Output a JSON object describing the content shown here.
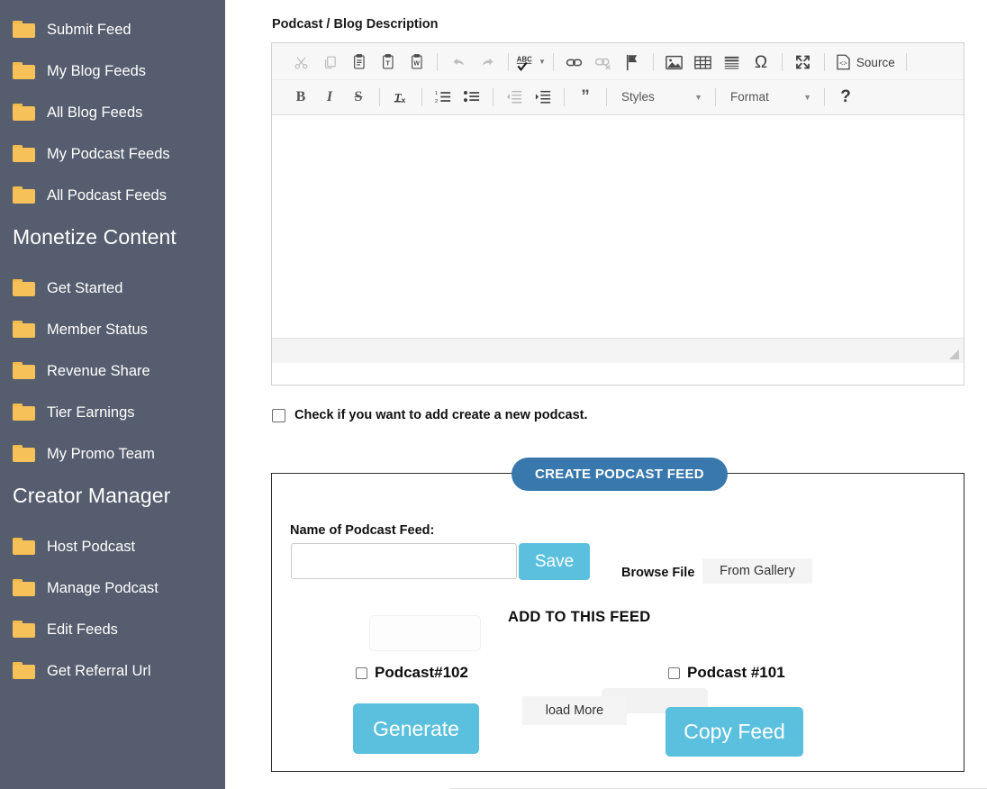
{
  "sidebar": {
    "groups": [
      {
        "title": null,
        "items": [
          {
            "label": "Submit Feed",
            "icon": "folder-icon"
          },
          {
            "label": "My Blog Feeds",
            "icon": "folder-icon"
          },
          {
            "label": "All Blog Feeds",
            "icon": "folder-icon"
          },
          {
            "label": "My Podcast Feeds",
            "icon": "folder-icon"
          },
          {
            "label": "All Podcast Feeds",
            "icon": "folder-icon"
          }
        ]
      },
      {
        "title": "Monetize Content",
        "items": [
          {
            "label": "Get Started",
            "icon": "folder-icon"
          },
          {
            "label": "Member Status",
            "icon": "folder-icon"
          },
          {
            "label": "Revenue Share",
            "icon": "folder-icon"
          },
          {
            "label": "Tier Earnings",
            "icon": "folder-icon"
          },
          {
            "label": "My Promo Team",
            "icon": "folder-icon"
          }
        ]
      },
      {
        "title": "Creator Manager",
        "items": [
          {
            "label": "Host Podcast",
            "icon": "folder-icon"
          },
          {
            "label": "Manage Podcast",
            "icon": "folder-icon"
          },
          {
            "label": "Edit Feeds",
            "icon": "folder-icon"
          },
          {
            "label": "Get Referral Url",
            "icon": "folder-icon"
          }
        ]
      }
    ]
  },
  "main": {
    "section_label": "Podcast / Blog Description",
    "editor": {
      "toolbar_row1": [
        {
          "name": "cut-icon",
          "title": "Cut",
          "enabled": false
        },
        {
          "name": "copy-icon",
          "title": "Copy",
          "enabled": false
        },
        {
          "name": "paste-icon",
          "title": "Paste",
          "enabled": true
        },
        {
          "name": "paste-as-plain-text-icon",
          "title": "Paste as plain text",
          "enabled": true
        },
        {
          "name": "paste-from-word-icon",
          "title": "Paste from Word",
          "enabled": true
        },
        {
          "name": "separator",
          "title": "",
          "enabled": true
        },
        {
          "name": "undo-icon",
          "title": "Undo",
          "enabled": false
        },
        {
          "name": "redo-icon",
          "title": "Redo",
          "enabled": false
        },
        {
          "name": "separator",
          "title": "",
          "enabled": true
        },
        {
          "name": "spell-check-icon",
          "title": "Spell Check As You Type",
          "enabled": true
        },
        {
          "name": "separator",
          "title": "",
          "enabled": true
        },
        {
          "name": "link-icon",
          "title": "Link",
          "enabled": true
        },
        {
          "name": "unlink-icon",
          "title": "Unlink",
          "enabled": false
        },
        {
          "name": "anchor-flag-icon",
          "title": "Anchor",
          "enabled": true
        },
        {
          "name": "separator",
          "title": "",
          "enabled": true
        },
        {
          "name": "image-icon",
          "title": "Image",
          "enabled": true
        },
        {
          "name": "table-icon",
          "title": "Table",
          "enabled": true
        },
        {
          "name": "horizontal-rule-icon",
          "title": "Horizontal Line",
          "enabled": true
        },
        {
          "name": "special-character-icon",
          "title": "Insert Special Character",
          "enabled": true
        },
        {
          "name": "separator",
          "title": "",
          "enabled": true
        },
        {
          "name": "maximize-icon",
          "title": "Maximize",
          "enabled": true
        },
        {
          "name": "separator",
          "title": "",
          "enabled": true
        },
        {
          "name": "source-icon",
          "title": "Source",
          "enabled": true
        }
      ],
      "source_label": "Source",
      "toolbar_row2": [
        {
          "name": "bold-icon",
          "title": "Bold",
          "enabled": true
        },
        {
          "name": "italic-icon",
          "title": "Italic",
          "enabled": true
        },
        {
          "name": "strikethrough-icon",
          "title": "Strike Through",
          "enabled": true
        },
        {
          "name": "separator",
          "title": "",
          "enabled": true
        },
        {
          "name": "remove-format-icon",
          "title": "Remove Format",
          "enabled": true
        },
        {
          "name": "separator",
          "title": "",
          "enabled": true
        },
        {
          "name": "numbered-list-icon",
          "title": "Insert/Remove Numbered List",
          "enabled": true
        },
        {
          "name": "bulleted-list-icon",
          "title": "Insert/Remove Bulleted List",
          "enabled": true
        },
        {
          "name": "separator",
          "title": "",
          "enabled": true
        },
        {
          "name": "decrease-indent-icon",
          "title": "Decrease Indent",
          "enabled": false
        },
        {
          "name": "increase-indent-icon",
          "title": "Increase Indent",
          "enabled": true
        },
        {
          "name": "separator",
          "title": "",
          "enabled": true
        },
        {
          "name": "blockquote-icon",
          "title": "Block Quote",
          "enabled": true
        }
      ],
      "styles_dropdown": "Styles",
      "format_dropdown": "Format",
      "help_label": "?",
      "content": ""
    },
    "new_podcast_checkbox": {
      "label": "Check if you want to add create a new podcast.",
      "checked": false
    },
    "feed_panel": {
      "legend": "CREATE PODCAST FEED",
      "name_label": "Name of Podcast Feed:",
      "name_value": "",
      "name_placeholder": "",
      "save_label": "Save",
      "browse_label": "Browse File",
      "gallery_label": "From Gallery",
      "add_title": "ADD TO THIS FEED",
      "podcasts": [
        {
          "label": "Podcast#102",
          "checked": false
        },
        {
          "label": "Podcast #101",
          "checked": false
        }
      ],
      "generate_label": "Generate",
      "load_more_label": "load More",
      "copy_feed_label": "Copy Feed"
    }
  },
  "colors": {
    "sidebar_bg": "#555d6e",
    "folder": "#f6c158",
    "accent_blue": "#3878ac",
    "button_blue": "#5bc0de",
    "toolbar_bg": "#f7f7f7"
  }
}
